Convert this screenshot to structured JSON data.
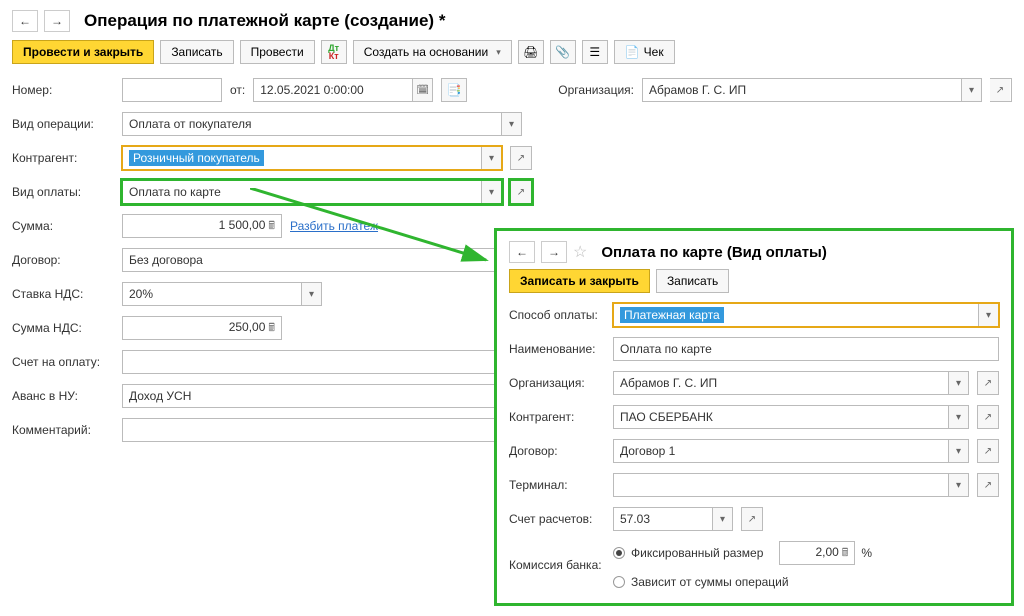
{
  "main": {
    "title": "Операция по платежной карте (создание) *",
    "toolbar": {
      "post_close": "Провести и закрыть",
      "save": "Записать",
      "post": "Провести",
      "create_based": "Создать на основании",
      "check": "Чек"
    },
    "form": {
      "number_label": "Номер:",
      "number_val": "",
      "date_label": "от:",
      "date_val": "12.05.2021 0:00:00",
      "org_label": "Организация:",
      "org_val": "Абрамов Г. С. ИП",
      "optype_label": "Вид операции:",
      "optype_val": "Оплата от покупателя",
      "counterparty_label": "Контрагент:",
      "counterparty_val": "Розничный покупатель",
      "paytype_label": "Вид оплаты:",
      "paytype_val": "Оплата по карте",
      "sum_label": "Сумма:",
      "sum_val": "1 500,00",
      "split_link": "Разбить платеж",
      "contract_label": "Договор:",
      "contract_val": "Без договора",
      "vat_rate_label": "Ставка НДС:",
      "vat_rate_val": "20%",
      "vat_sum_label": "Сумма НДС:",
      "vat_sum_val": "250,00",
      "invoice_label": "Счет на оплату:",
      "invoice_val": "",
      "advance_label": "Аванс в НУ:",
      "advance_val": "Доход УСН",
      "comment_label": "Комментарий:",
      "comment_val": ""
    }
  },
  "popup": {
    "title": "Оплата по карте (Вид оплаты)",
    "toolbar": {
      "save_close": "Записать и закрыть",
      "save": "Записать"
    },
    "form": {
      "method_label": "Способ оплаты:",
      "method_val": "Платежная карта",
      "name_label": "Наименование:",
      "name_val": "Оплата по карте",
      "org_label": "Организация:",
      "org_val": "Абрамов Г. С. ИП",
      "cp_label": "Контрагент:",
      "cp_val": "ПАО СБЕРБАНК",
      "contract_label": "Договор:",
      "contract_val": "Договор 1",
      "terminal_label": "Терминал:",
      "terminal_val": "",
      "account_label": "Счет расчетов:",
      "account_val": "57.03",
      "commission_label": "Комиссия банка:",
      "commission_fixed_label": "Фиксированный размер",
      "commission_fixed_val": "2,00",
      "commission_pct": "%",
      "commission_depends_label": "Зависит от суммы операций"
    }
  }
}
